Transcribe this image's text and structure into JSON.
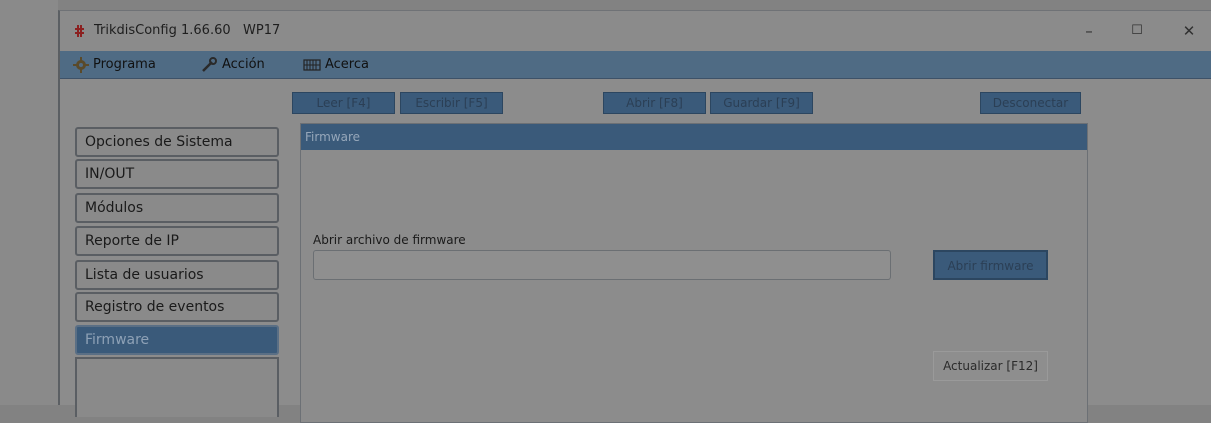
{
  "window": {
    "title": "TrikdisConfig 1.66.60   WP17",
    "controls": {
      "minimize": "–",
      "maximize": "☐",
      "close": "✕"
    }
  },
  "menu": [
    {
      "label": "Programa",
      "icon": "gear-icon"
    },
    {
      "label": "Acción",
      "icon": "wrench-icon"
    },
    {
      "label": "Acerca",
      "icon": "keyboard-icon"
    }
  ],
  "toolbar": {
    "read": "Leer [F4]",
    "write": "Escribir [F5]",
    "open": "Abrir [F8]",
    "save": "Guardar [F9]",
    "disconnect": "Desconectar"
  },
  "sidebar": {
    "items": [
      {
        "label": "Opciones de Sistema",
        "active": false
      },
      {
        "label": "IN/OUT",
        "active": false
      },
      {
        "label": "Módulos",
        "active": false
      },
      {
        "label": "Reporte de IP",
        "active": false
      },
      {
        "label": "Lista de usuarios",
        "active": false
      },
      {
        "label": "Registro de eventos",
        "active": false
      },
      {
        "label": "Firmware",
        "active": true
      }
    ]
  },
  "panel": {
    "title": "Firmware",
    "file_label": "Abrir archivo de firmware",
    "file_value": "",
    "open_button": "Abrir firmware",
    "update_button": "Actualizar [F12]"
  },
  "colors": {
    "accent": "#3a5a7a",
    "menubar": "#4f6b84",
    "overlay_background": "#8c8c8c",
    "app_icon": "#8b2020"
  }
}
